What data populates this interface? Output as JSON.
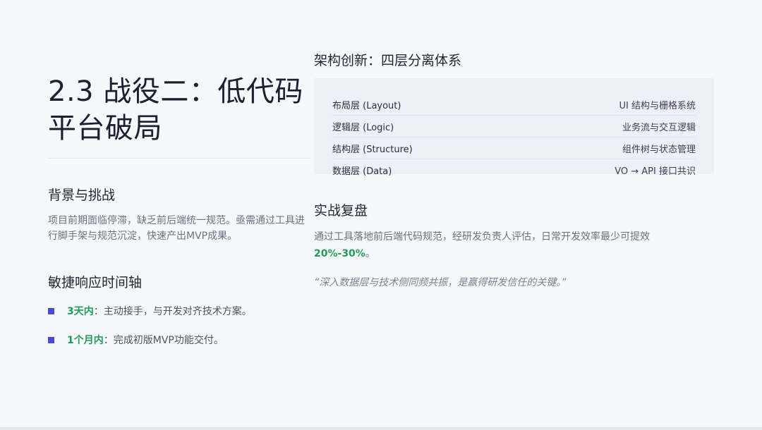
{
  "slide": {
    "title": "2.3 战役二：低代码平台破局",
    "background": {
      "heading": "背景与挑战",
      "text": "项目前期面临停滞，缺乏前后端统一规范。亟需通过工具进行脚手架与规范沉淀，快速产出MVP成果。"
    },
    "timeline": {
      "heading": "敏捷响应时间轴",
      "items": [
        {
          "highlight": "3天内",
          "text": "：主动接手，与开发对齐技术方案。"
        },
        {
          "highlight": "1个月内",
          "text": "：完成初版MVP功能交付。"
        }
      ]
    },
    "architecture": {
      "heading": "架构创新：四层分离体系",
      "rows": [
        {
          "layer": "布局层 (Layout)",
          "desc": "UI 结构与栅格系统"
        },
        {
          "layer": "逻辑层 (Logic)",
          "desc": "业务流与交互逻辑"
        },
        {
          "layer": "结构层 (Structure)",
          "desc": "组件树与状态管理"
        },
        {
          "layer": "数据层 (Data)",
          "desc": "VO → API 接口共识"
        }
      ]
    },
    "review": {
      "heading": "实战复盘",
      "text_prefix": "通过工具落地前后端代码规范，经研发负责人评估，日常开发效率最少可提效",
      "highlight": "20%-30%",
      "text_suffix": "。",
      "quote": "“深入数据层与技术侧同频共振，是赢得研发信任的关键。”"
    },
    "colors": {
      "accent_green": "#1f9c5a",
      "bullet_purple": "#4b48d6"
    }
  }
}
